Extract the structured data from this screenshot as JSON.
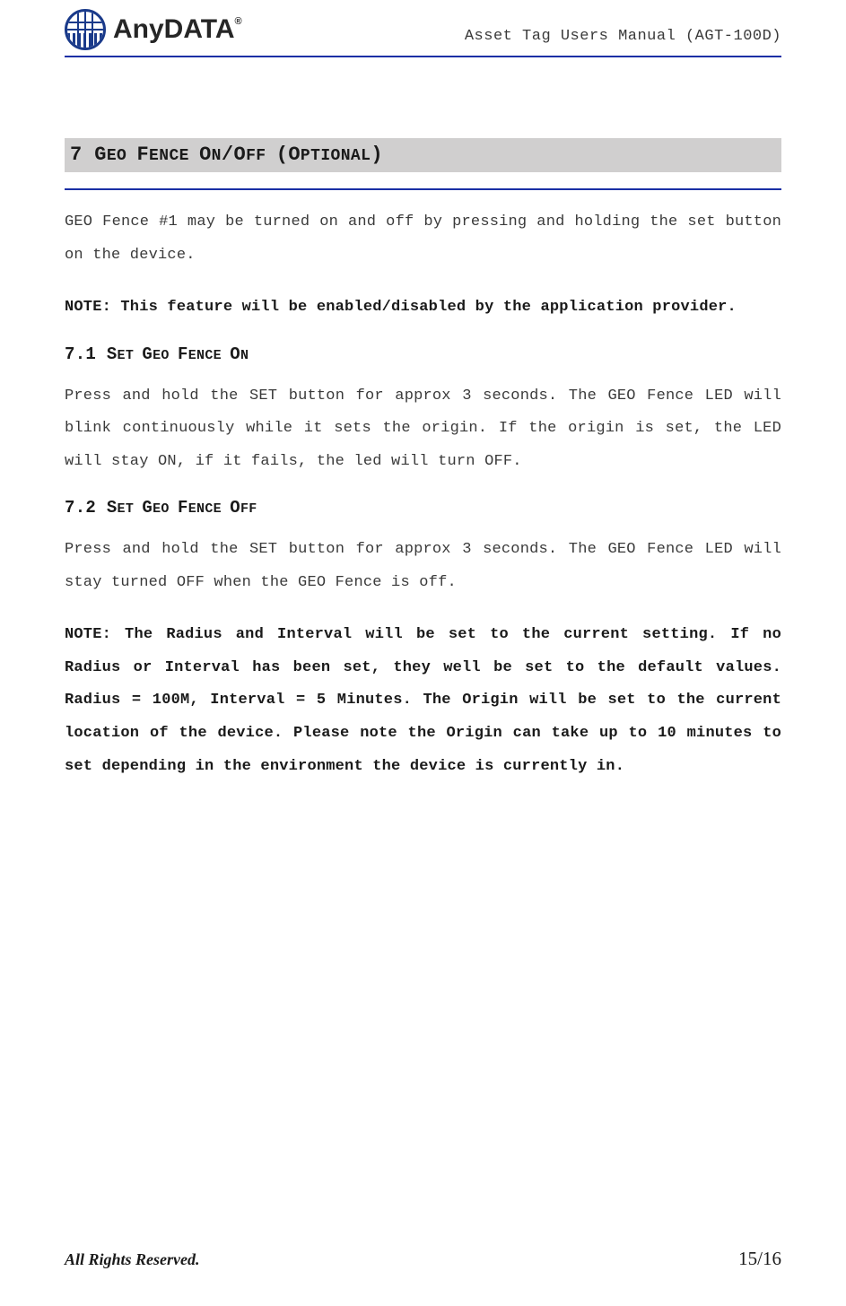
{
  "header": {
    "brand": "AnyDATA",
    "brand_mark": "®",
    "doc_title": "Asset Tag Users Manual (AGT-100D)"
  },
  "section": {
    "number": "7",
    "title_lead": "G",
    "title_rest": "EO ",
    "title_lead2": "F",
    "title_rest2": "ENCE ",
    "title_lead3": "O",
    "title_rest3": "N",
    "slash": "/",
    "title_lead4": "O",
    "title_rest4": "FF ",
    "open_paren": "(",
    "title_lead5": "O",
    "title_rest5": "PTIONAL",
    "close_paren": ")"
  },
  "intro_para": "GEO Fence #1 may be turned on and off by pressing and holding the set button on the device.",
  "note1": "NOTE: This feature will be enabled/disabled by the application provider.",
  "sub_7_1": {
    "num": "7.1",
    "t1": "S",
    "t1r": "ET ",
    "t2": "G",
    "t2r": "EO ",
    "t3": "F",
    "t3r": "ENCE ",
    "t4": "O",
    "t4r": "N"
  },
  "para_7_1": "Press and hold the SET button for approx 3 seconds. The GEO Fence LED will blink continuously while it sets the origin. If the origin is set, the LED will stay ON, if it fails, the led will turn OFF.",
  "sub_7_2": {
    "num": "7.2 ",
    "t1": "S",
    "t1r": "ET ",
    "t2": "G",
    "t2r": "EO ",
    "t3": "F",
    "t3r": "ENCE ",
    "t4": "O",
    "t4r": "FF"
  },
  "para_7_2": "Press and hold the SET button for approx 3 seconds. The GEO Fence LED will stay turned OFF when the GEO Fence is off.",
  "note2": "NOTE: The Radius and Interval will be set to the current setting. If no Radius or Interval has been set, they well be set to the default values. Radius = 100M, Interval = 5 Minutes. The Origin will be set to the current location of the device. Please note the Origin can take up to 10 minutes to set depending in the environment the device is currently in.",
  "footer": {
    "left": "All Rights Reserved.",
    "right": "15/16"
  }
}
